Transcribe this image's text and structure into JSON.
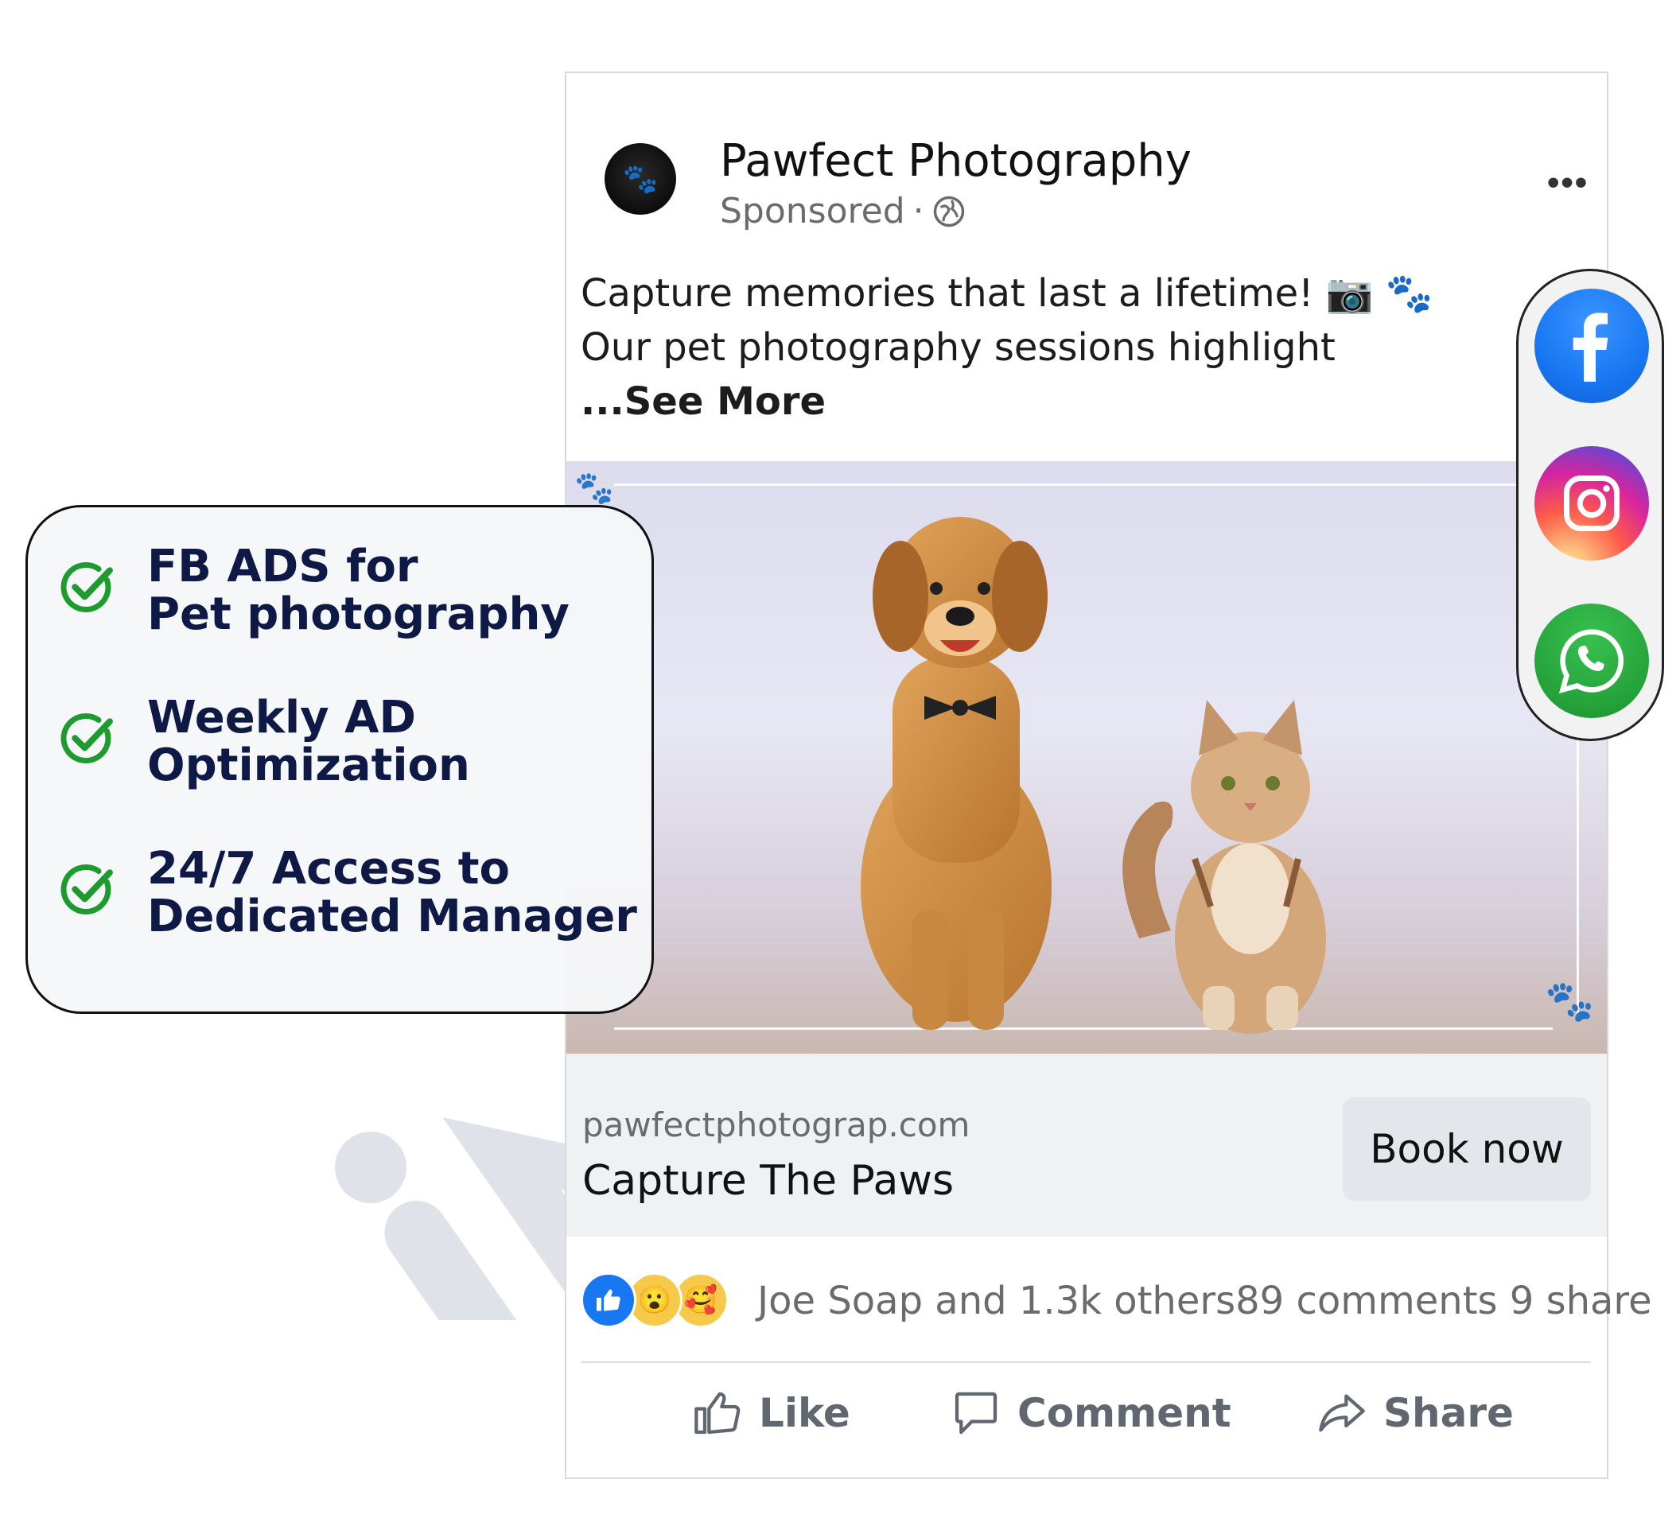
{
  "post": {
    "page_name": "Pawfect Photography",
    "sponsored": "Sponsored",
    "separator": "·",
    "caption_line1": "Capture memories that last a lifetime!",
    "caption_line2": "Our pet photography sessions highlight",
    "see_more": "...See More",
    "link_domain": "pawfectphotograp.com",
    "link_headline": "Capture The Paws",
    "cta_button": "Book now",
    "reactions_text": "Joe Soap and 1.3k others89 comments 9 share",
    "actions": {
      "like": "Like",
      "comment": "Comment",
      "share": "Share"
    }
  },
  "features": [
    {
      "line1": "FB ADS for",
      "line2": "Pet photography"
    },
    {
      "line1": "Weekly AD",
      "line2": "Optimization"
    },
    {
      "line1": "24/7 Access to",
      "line2": "Dedicated Manager"
    }
  ],
  "social": [
    "facebook-icon",
    "instagram-icon",
    "whatsapp-icon"
  ],
  "colors": {
    "feature_text": "#0e1a45",
    "check_green": "#1e9b2e",
    "facebook_blue": "#1877f2",
    "whatsapp_green": "#25a23a",
    "cta_bg": "#e4e6eb"
  }
}
